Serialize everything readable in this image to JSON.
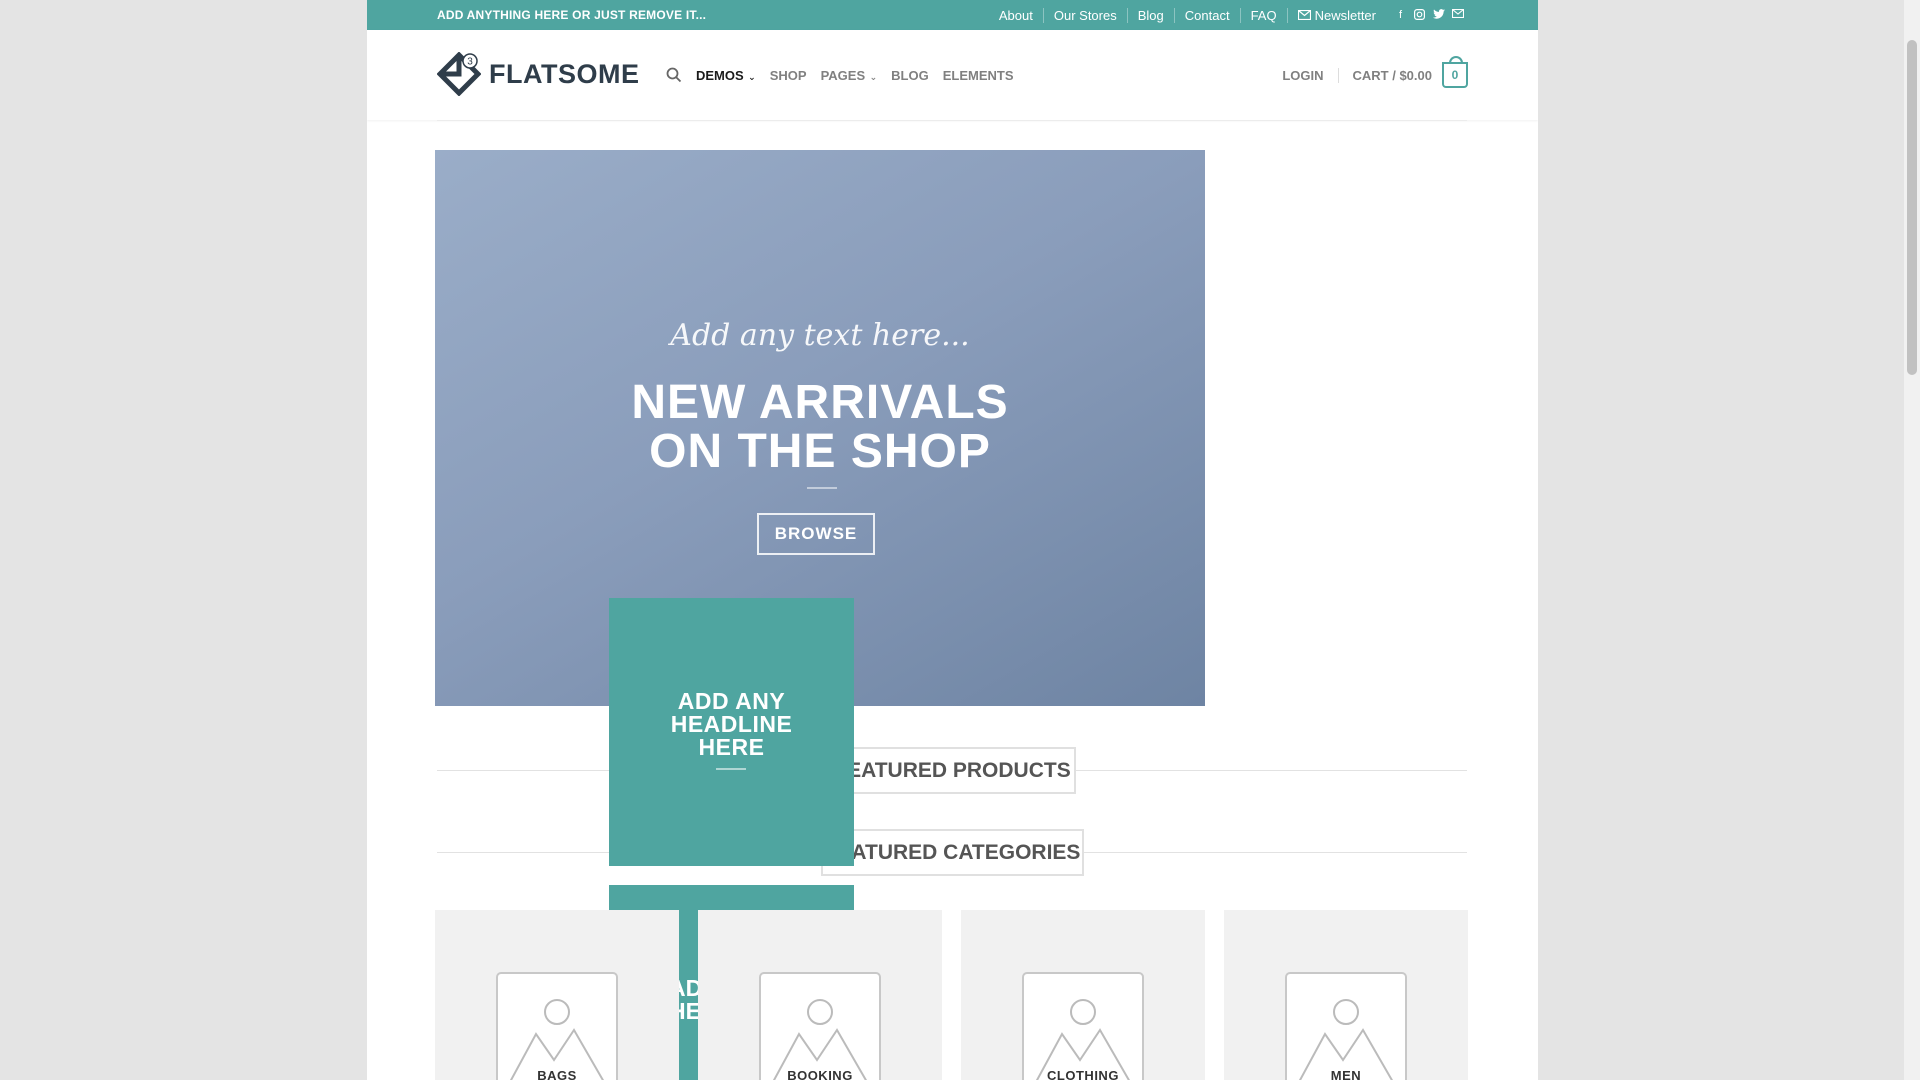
{
  "topbar": {
    "promo": "ADD ANYTHING HERE OR JUST REMOVE IT...",
    "links": [
      "About",
      "Our Stores",
      "Blog",
      "Contact",
      "FAQ"
    ],
    "newsletter": "Newsletter",
    "social_icons": [
      "facebook-icon",
      "instagram-icon",
      "twitter-icon",
      "email-icon"
    ]
  },
  "header": {
    "logo_text": "FLATSOME",
    "logo_badge": "3",
    "nav": [
      {
        "label": "DEMOS",
        "dropdown": true
      },
      {
        "label": "SHOP",
        "dropdown": false
      },
      {
        "label": "PAGES",
        "dropdown": true
      },
      {
        "label": "BLOG",
        "dropdown": false
      },
      {
        "label": "ELEMENTS",
        "dropdown": false
      }
    ],
    "login": "LOGIN",
    "cart": "CART / $0.00",
    "cart_count": "0"
  },
  "hero": {
    "script_text": "Add any text here...",
    "headline_line1": "NEW ARRIVALS",
    "headline_line2": "ON THE SHOP",
    "button": "BROWSE"
  },
  "banner": {
    "headline_line1": "ADD ANY",
    "headline_line2": "HEADLINE",
    "headline_line3": "HERE",
    "partial_line1": "AD",
    "partial_line2": "HE"
  },
  "sections": {
    "featured_products": "FEATURED PRODUCTS",
    "featured_categories": "FEATURED CATEGORIES"
  },
  "categories": [
    "BAGS",
    "BOOKING",
    "CLOTHING",
    "MEN"
  ],
  "colors": {
    "primary": "#4fa5a0",
    "hero_start": "#9aadc8",
    "hero_end": "#6e84a3",
    "logo_dark": "#2f3d4a"
  }
}
